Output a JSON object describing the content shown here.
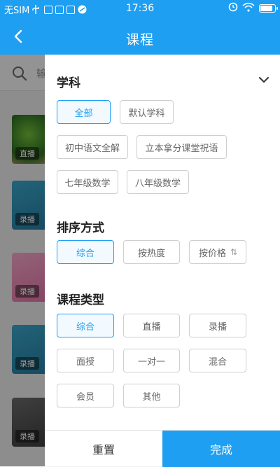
{
  "status_bar": {
    "carrier": "无SIM",
    "time": "17:36"
  },
  "header": {
    "title": "课程",
    "back_icon": "chevron-left-icon"
  },
  "background": {
    "search_placeholder": "输",
    "list_tags": [
      "直播",
      "录播",
      "录播",
      "录播",
      "录播"
    ]
  },
  "filter": {
    "subject": {
      "title": "学科",
      "options": [
        "全部",
        "默认学科",
        "初中语文全解",
        "立本拿分课堂祝语",
        "七年级数学",
        "八年级数学"
      ],
      "selected": "全部"
    },
    "sort": {
      "title": "排序方式",
      "options": [
        "综合",
        "按热度",
        "按价格"
      ],
      "selected": "综合"
    },
    "type": {
      "title": "课程类型",
      "options": [
        "综合",
        "直播",
        "录播",
        "面授",
        "一对一",
        "混合",
        "会员",
        "其他"
      ],
      "selected": "综合"
    },
    "reset_label": "重置",
    "done_label": "完成"
  },
  "colors": {
    "accent": "#1e9ff2",
    "chip_border": "#cfcfcf",
    "text_primary": "#222222"
  }
}
